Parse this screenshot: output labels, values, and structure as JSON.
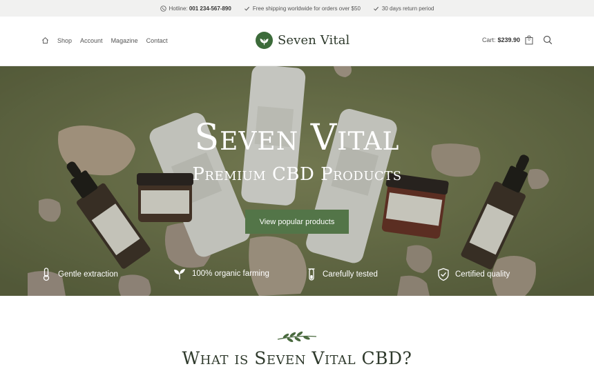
{
  "topbar": {
    "hotline_label": "Hotline:",
    "hotline_number": "001 234-567-890",
    "shipping": "Free shipping worldwide for orders over $50",
    "returns": "30 days return period"
  },
  "nav": {
    "items": [
      "Shop",
      "Account",
      "Magazine",
      "Contact"
    ]
  },
  "logo": {
    "text": "Seven Vital"
  },
  "cart": {
    "label": "Cart:",
    "amount": "$239.90",
    "count": "0"
  },
  "hero": {
    "title": "Seven Vital",
    "subtitle": "Premium CBD Products",
    "button": "View popular products",
    "features": [
      "Gentle extraction",
      "100% organic farming",
      "Carefully tested",
      "Certified quality"
    ]
  },
  "section": {
    "title": "What is Seven Vital CBD?"
  },
  "colors": {
    "accent": "#537548",
    "brand": "#3c6b3a",
    "hero_bg": "#6f7649"
  }
}
